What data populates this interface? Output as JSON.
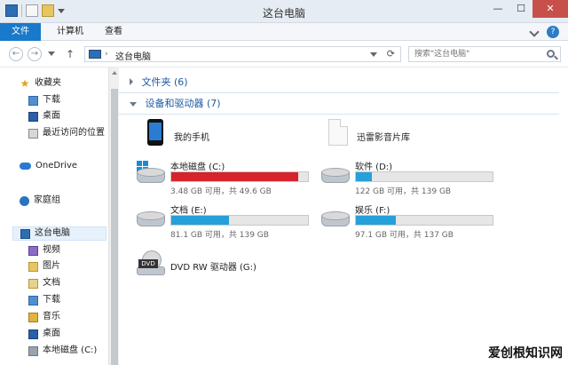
{
  "window": {
    "title": "这台电脑",
    "buttons": {
      "minimize": "—",
      "maximize": "☐",
      "close": "✕"
    }
  },
  "ribbon": {
    "tabs": [
      "文件",
      "计算机",
      "查看"
    ],
    "help": "?"
  },
  "address": {
    "separator": "›",
    "crumb": "这台电脑",
    "refresh": "⟳"
  },
  "search": {
    "placeholder": "搜索\"这台电脑\""
  },
  "nav": {
    "favorites": "收藏夹",
    "items": {
      "download": "下载",
      "desktop": "桌面",
      "recent": "最近访问的位置",
      "onedrive": "OneDrive",
      "homegroup": "家庭组",
      "thispc": "这台电脑",
      "videos": "视频",
      "pictures": "图片",
      "documents": "文档",
      "downloads2": "下载",
      "music": "音乐",
      "desktop2": "桌面",
      "localdisk": "本地磁盘 (C:)"
    }
  },
  "main": {
    "folders_header": "文件夹 (6)",
    "devices_header": "设备和驱动器 (7)",
    "items": {
      "phone": "我的手机",
      "thunder": "迅雷影音片库"
    },
    "drives": [
      {
        "name": "本地磁盘 (C:)",
        "info": "3.48 GB 可用，共 49.6 GB",
        "used_fraction": 0.93,
        "color": "#d6232c"
      },
      {
        "name": "软件 (D:)",
        "info": "122 GB 可用，共 139 GB",
        "used_fraction": 0.12,
        "color": "#26a0da"
      },
      {
        "name": "文档 (E:)",
        "info": "81.1 GB 可用，共 139 GB",
        "used_fraction": 0.42,
        "color": "#26a0da"
      },
      {
        "name": "娱乐 (F:)",
        "info": "97.1 GB 可用，共 137 GB",
        "used_fraction": 0.29,
        "color": "#26a0da"
      }
    ],
    "dvd": {
      "name": "DVD RW 驱动器 (G:)",
      "badge": "DVD"
    }
  },
  "watermark": "爱创根知识网"
}
